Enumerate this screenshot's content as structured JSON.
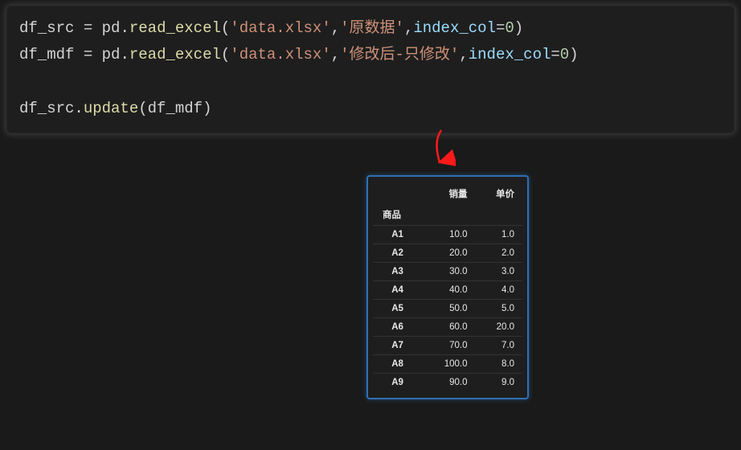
{
  "code": {
    "line1": {
      "var": "df_src",
      "assign": " = ",
      "mod": "pd",
      "dot": ".",
      "fn": "read_excel",
      "open": "(",
      "arg1": "'data.xlsx'",
      "comma1": ",",
      "arg2": "'原数据'",
      "comma2": ",",
      "kw": "index_col",
      "eq": "=",
      "val": "0",
      "close": ")"
    },
    "line2": {
      "var": "df_mdf",
      "assign": " = ",
      "mod": "pd",
      "dot": ".",
      "fn": "read_excel",
      "open": "(",
      "arg1": "'data.xlsx'",
      "comma1": ",",
      "arg2": "'修改后-只修改'",
      "comma2": ",",
      "kw": "index_col",
      "eq": "=",
      "val": "0",
      "close": ")"
    },
    "line3": {
      "obj": "df_src",
      "dot": ".",
      "fn": "update",
      "open": "(",
      "arg": "df_mdf",
      "close": ")"
    }
  },
  "output": {
    "columns": {
      "c1": "销量",
      "c2": "单价"
    },
    "index_name": "商品",
    "rows": [
      {
        "idx": "A1",
        "v1": "10.0",
        "v2": "1.0"
      },
      {
        "idx": "A2",
        "v1": "20.0",
        "v2": "2.0"
      },
      {
        "idx": "A3",
        "v1": "30.0",
        "v2": "3.0"
      },
      {
        "idx": "A4",
        "v1": "40.0",
        "v2": "4.0"
      },
      {
        "idx": "A5",
        "v1": "50.0",
        "v2": "5.0"
      },
      {
        "idx": "A6",
        "v1": "60.0",
        "v2": "20.0"
      },
      {
        "idx": "A7",
        "v1": "70.0",
        "v2": "7.0"
      },
      {
        "idx": "A8",
        "v1": "100.0",
        "v2": "8.0"
      },
      {
        "idx": "A9",
        "v1": "90.0",
        "v2": "9.0"
      }
    ]
  },
  "chart_data": {
    "type": "table",
    "index_name": "商品",
    "columns": [
      "销量",
      "单价"
    ],
    "index": [
      "A1",
      "A2",
      "A3",
      "A4",
      "A5",
      "A6",
      "A7",
      "A8",
      "A9"
    ],
    "data": [
      [
        10.0,
        1.0
      ],
      [
        20.0,
        2.0
      ],
      [
        30.0,
        3.0
      ],
      [
        40.0,
        4.0
      ],
      [
        50.0,
        5.0
      ],
      [
        60.0,
        20.0
      ],
      [
        70.0,
        7.0
      ],
      [
        100.0,
        8.0
      ],
      [
        90.0,
        9.0
      ]
    ]
  }
}
